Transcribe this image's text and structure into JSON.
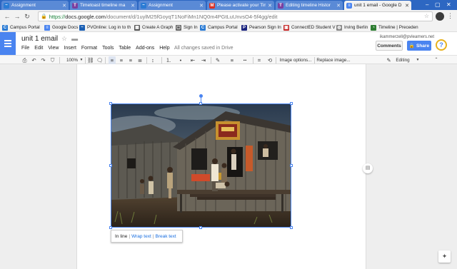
{
  "browser": {
    "tabs": [
      {
        "title": "Assignment",
        "color": "#2a7bd4",
        "glyph": "~"
      },
      {
        "title": "Timetoast timeline ma",
        "color": "#7b3fa0",
        "glyph": "T"
      },
      {
        "title": "Assignment",
        "color": "#2a7bd4",
        "glyph": "~"
      },
      {
        "title": "Please activate your Tim",
        "color": "#d93025",
        "glyph": "M"
      },
      {
        "title": "Editing timeline Histor",
        "color": "#7b3fa0",
        "glyph": "T"
      },
      {
        "title": "unit 1 email - Google D",
        "color": "#4a84f0",
        "glyph": "≡"
      }
    ],
    "url_scheme": "https://",
    "url_host": "docs.google.com",
    "url_path": "/document/d/1uylM25fGoyqT1NoFiMn1NQ0m4PGtLuUnvsO4-5f4gg/edit",
    "bookmarks": [
      {
        "label": "Campus Portal",
        "color": "#2a7bd4",
        "glyph": "C"
      },
      {
        "label": "Google Docs",
        "color": "#4a84f0",
        "glyph": "≡"
      },
      {
        "label": "PVOnline: Log in to th",
        "color": "#1a5fb4",
        "glyph": "~"
      },
      {
        "label": "Create A Graph",
        "color": "#555555",
        "glyph": "▦"
      },
      {
        "label": "Sign In",
        "color": "#666666",
        "glyph": "▢"
      },
      {
        "label": "Campus Portal",
        "color": "#2a7bd4",
        "glyph": "C"
      },
      {
        "label": "Pearson Sign In",
        "color": "#1a237e",
        "glyph": "P"
      },
      {
        "label": "ConnectED Student V",
        "color": "#c62828",
        "glyph": "▣"
      },
      {
        "label": "Irving Berlin",
        "color": "#888888",
        "glyph": "◍"
      },
      {
        "label": "Timeline | Preceden",
        "color": "#2e7d32",
        "glyph": "◔"
      }
    ]
  },
  "docs": {
    "title": "unit 1 email",
    "menu": [
      "File",
      "Edit",
      "View",
      "Insert",
      "Format",
      "Tools",
      "Table",
      "Add-ons",
      "Help"
    ],
    "saved_status": "All changes saved in Drive",
    "user_email": "ikammerzell@pvlearners.net",
    "comments_label": "Comments",
    "share_label": "Share",
    "avatar_letter": "?"
  },
  "toolbar": {
    "zoom": "100%",
    "image_options": "Image options...",
    "replace_image": "Replace image...",
    "mode": "Editing"
  },
  "image_wrap": {
    "options": [
      "In line",
      "Wrap text",
      "Break text"
    ],
    "selected": "In line"
  }
}
